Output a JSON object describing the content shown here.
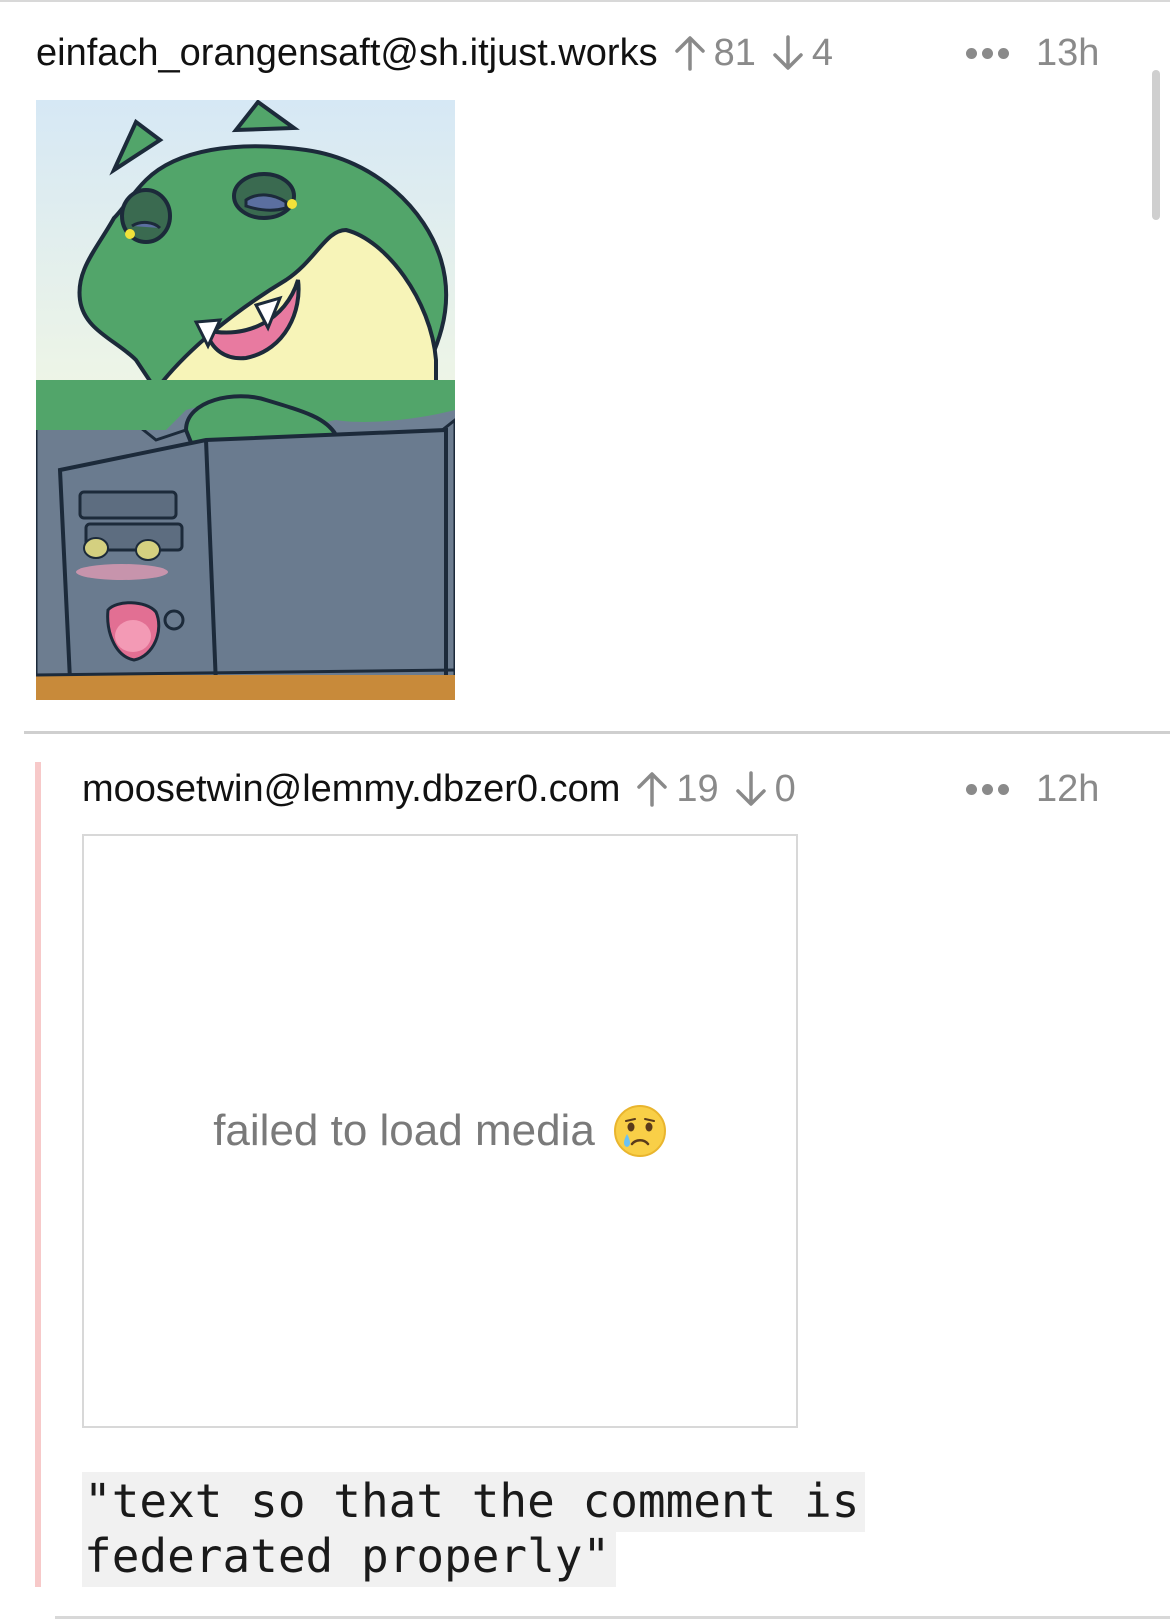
{
  "comments": [
    {
      "username": "einfach_orangensaft@sh.itjust.works",
      "upvotes": "81",
      "downvotes": "4",
      "time": "13h",
      "icons": {
        "upvote": "arrow-up-icon",
        "downvote": "arrow-down-icon",
        "more": "more-options-icon"
      }
    },
    {
      "username": "moosetwin@lemmy.dbzer0.com",
      "upvotes": "19",
      "downvotes": "0",
      "time": "12h",
      "media_error": "failed to load media",
      "media_emoji": "crying-face-icon",
      "code_text": "\"text so that the comment is federated properly\""
    }
  ],
  "colors": {
    "thread_line": "#f7c9c9",
    "meta_gray": "#8a8a8a"
  }
}
